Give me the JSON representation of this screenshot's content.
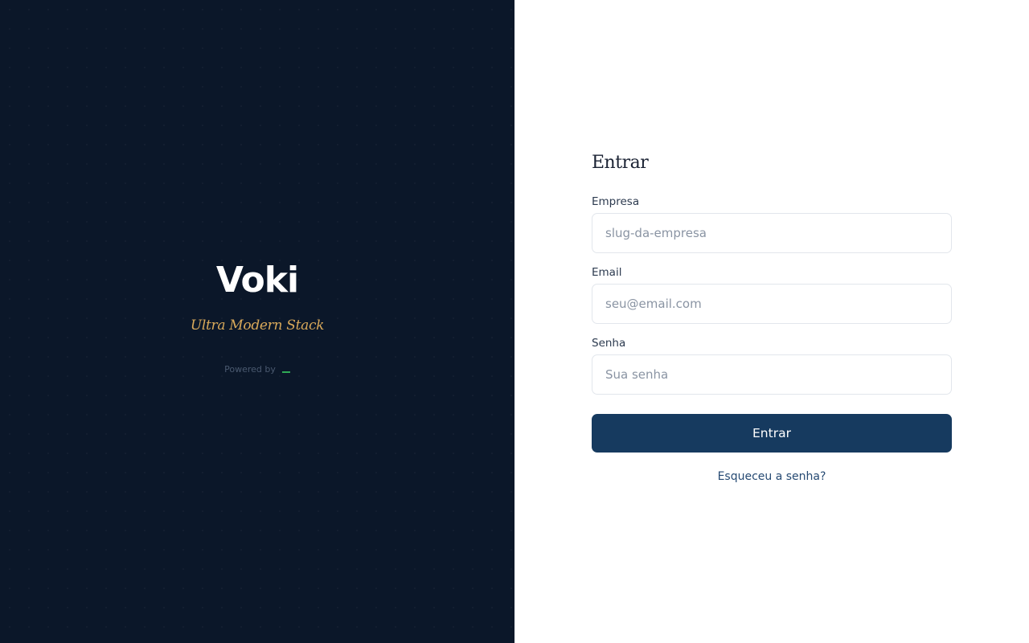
{
  "brand": {
    "name": "Voki",
    "tagline": "Ultra Modern Stack",
    "powered_by": "Powered by",
    "powered_mark": "_"
  },
  "login": {
    "title": "Entrar",
    "fields": {
      "company": {
        "label": "Empresa",
        "placeholder": "slug-da-empresa",
        "value": ""
      },
      "email": {
        "label": "Email",
        "placeholder": "seu@email.com",
        "value": ""
      },
      "password": {
        "label": "Senha",
        "placeholder": "Sua senha",
        "value": ""
      }
    },
    "submit_label": "Entrar",
    "forgot_label": "Esqueceu a senha?"
  },
  "colors": {
    "brand_panel_bg": "#0b1729",
    "tagline": "#d9a95a",
    "primary_button": "#163a5f",
    "powered_mark": "#2faa55"
  }
}
